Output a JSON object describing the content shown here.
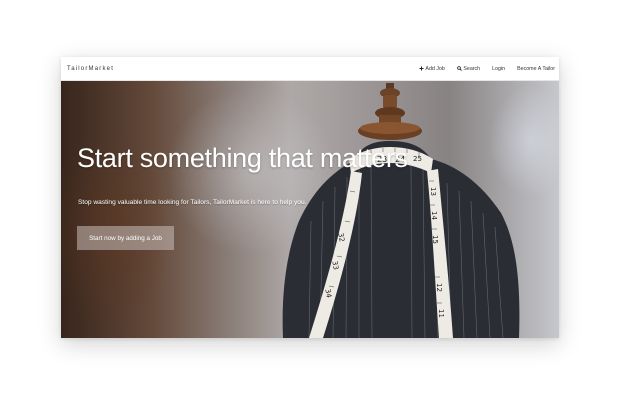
{
  "navbar": {
    "brand": "TailorMarket",
    "links": {
      "add_job": "Add Job",
      "search": "Search",
      "login": "Login",
      "become_tailor": "Become A Tailor"
    }
  },
  "hero": {
    "title": "Start something that matters",
    "subtitle": "Stop wasting valuable time looking for Tailors, TailorMarket is here to help you.",
    "cta_label": "Start now by adding a Job"
  },
  "tape_numbers": [
    "23",
    "24",
    "25",
    "13",
    "14",
    "15",
    "32",
    "33",
    "34",
    "12",
    "11"
  ],
  "icons": {
    "add": "plus-icon",
    "search": "search-icon"
  }
}
